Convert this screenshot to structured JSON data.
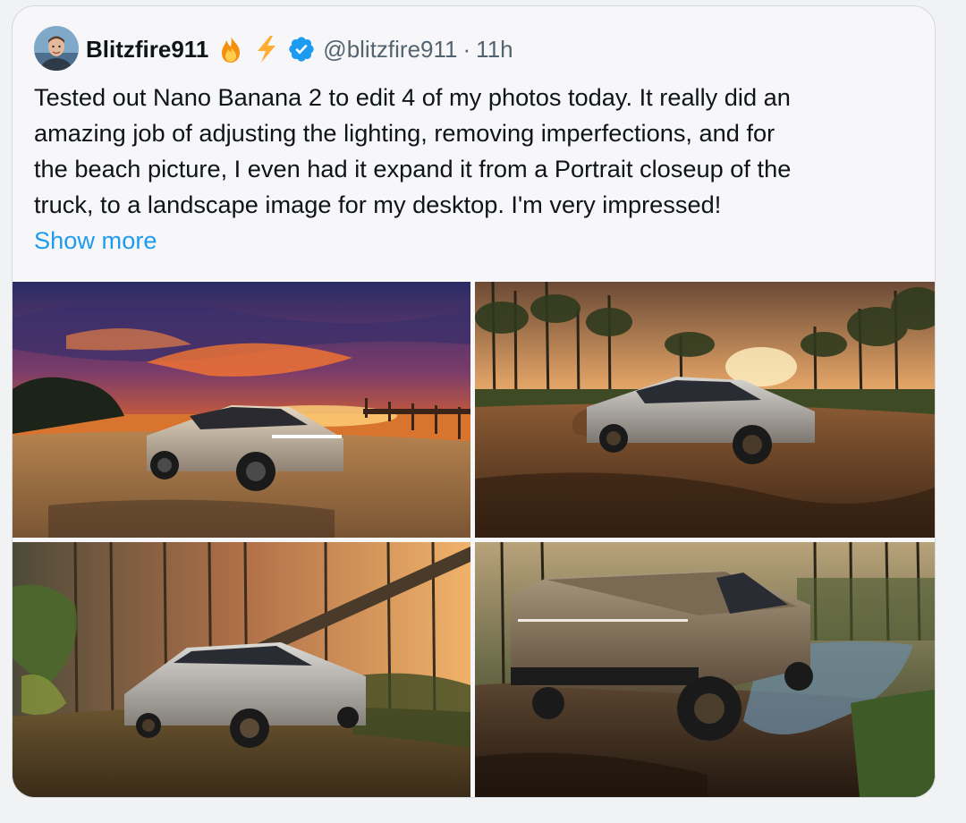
{
  "post": {
    "author_name": "Blitzfire911",
    "author_emojis": [
      "fire-emoji",
      "lightning-emoji"
    ],
    "verified_icon": "verified-badge-icon",
    "handle": "@blitzfire911",
    "separator": "·",
    "time": "11h",
    "text_lines": [
      "Tested out Nano Banana 2 to edit 4 of my photos today. It really did an",
      "amazing job of adjusting the lighting, removing imperfections, and for",
      "the beach picture, I even had it expand it from a Portrait closeup of the",
      "truck, to a landscape image for my desktop. I'm very impressed!"
    ],
    "show_more_label": "Show more"
  },
  "media": {
    "photos": [
      {
        "name": "beach-sunset-photo"
      },
      {
        "name": "muddy-forest-clearing-photo"
      },
      {
        "name": "fallen-tree-forest-photo"
      },
      {
        "name": "muddy-creek-photo"
      }
    ]
  },
  "colors": {
    "link": "#1d9bf0",
    "verified": "#1d9bf0",
    "text": "#0f1419",
    "muted": "#536471"
  }
}
